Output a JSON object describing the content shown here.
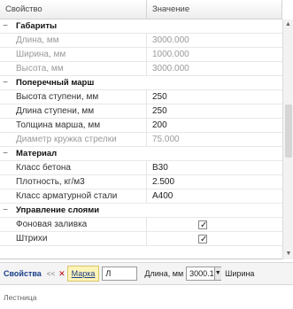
{
  "grid": {
    "header": {
      "name": "Свойство",
      "value": "Значение"
    },
    "categories": [
      {
        "label": "Габариты",
        "toggle": "−",
        "rows": [
          {
            "name": "Длина, мм",
            "value": "3000.000",
            "disabled": true
          },
          {
            "name": "Ширина, мм",
            "value": "1000.000",
            "disabled": true
          },
          {
            "name": "Высота, мм",
            "value": "3000.000",
            "disabled": true
          }
        ]
      },
      {
        "label": "Поперечный марш",
        "toggle": "−",
        "rows": [
          {
            "name": "Высота ступени, мм",
            "value": "250"
          },
          {
            "name": "Длина ступени, мм",
            "value": "250"
          },
          {
            "name": "Толщина марша, мм",
            "value": "200"
          },
          {
            "name": "Диаметр кружка стрелки",
            "value": "75.000",
            "disabled": true
          }
        ]
      },
      {
        "label": "Материал",
        "toggle": "−",
        "rows": [
          {
            "name": "Класс бетона",
            "value": "B30"
          },
          {
            "name": "Плотность, кг/м3",
            "value": "2.500"
          },
          {
            "name": "Класс арматурной стали",
            "value": "A400"
          }
        ]
      },
      {
        "label": "Управление слоями",
        "toggle": "−",
        "rows": [
          {
            "name": "Фоновая заливка",
            "checked": true
          },
          {
            "name": "Штрихи",
            "checked": true
          }
        ]
      }
    ]
  },
  "toolbar": {
    "title": "Свойства",
    "nav": "<<",
    "close": "✕",
    "tab": "Марка",
    "input_value": "Л",
    "label_length": "Длина, мм",
    "combo_value": "3000.1",
    "label_width": "Ширина"
  },
  "status": {
    "tab": "Лестница"
  },
  "colors": {
    "accent": "#1a3e8a",
    "highlight": "#fff4b8"
  }
}
